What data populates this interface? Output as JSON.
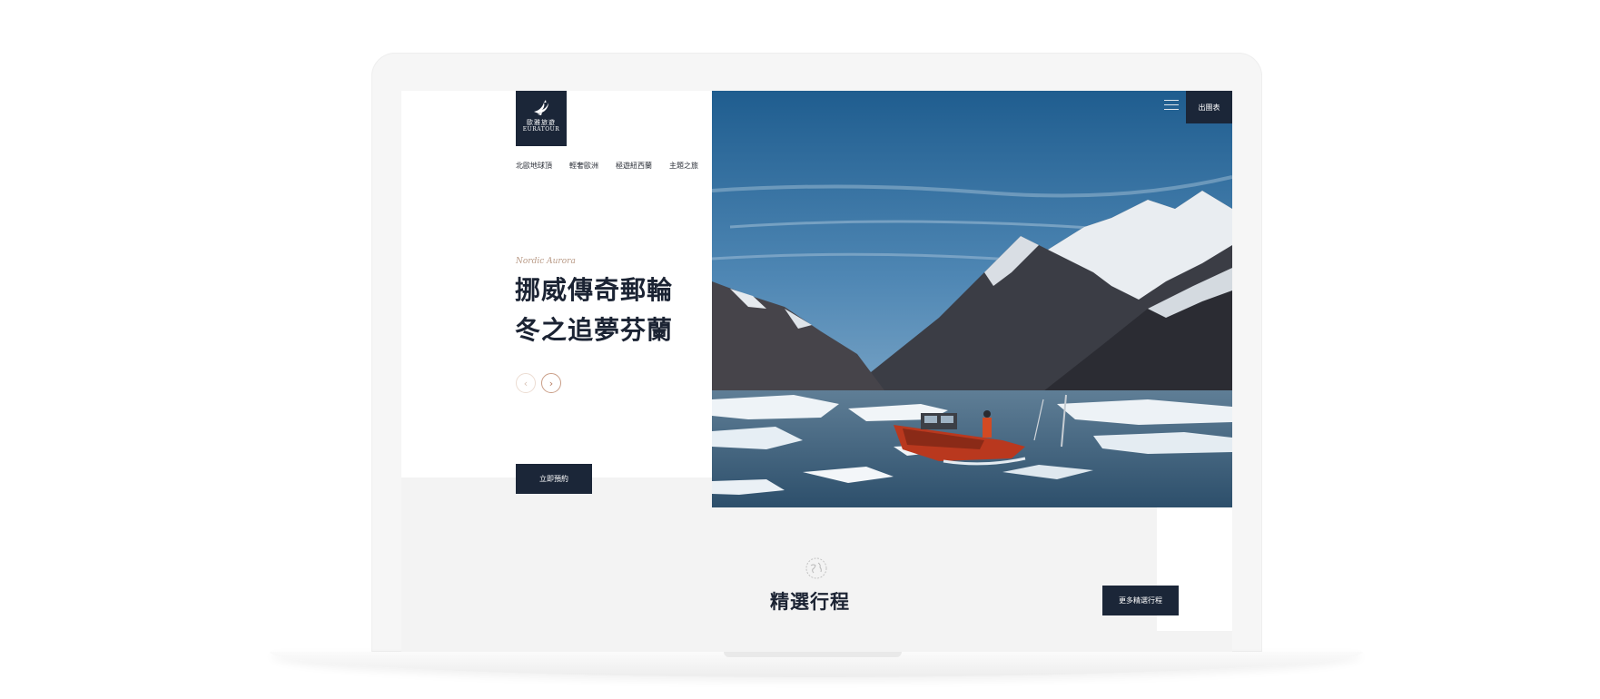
{
  "brand": {
    "name_cn": "歐雅旅遊",
    "name_en": "EURATOUR",
    "logo_icon": "bird-icon"
  },
  "nav": {
    "items": [
      "北歐地球頂",
      "輕奢歐洲",
      "極遊紐西蘭",
      "主題之旅"
    ]
  },
  "hero": {
    "tagline": "Nordic Aurora",
    "headline_line1": "挪威傳奇郵輪",
    "headline_line2": "冬之追夢芬蘭",
    "prev_icon": "chevron-left-icon",
    "next_icon": "chevron-right-icon",
    "prev_glyph": "‹",
    "next_glyph": "›",
    "book_label": "立即預約",
    "image_subject": "arctic-fjord-boat-photo"
  },
  "header": {
    "menu_icon": "hamburger-icon",
    "table_label": "出團表"
  },
  "featured": {
    "icon": "globe-icon",
    "title": "精選行程",
    "more_label": "更多精選行程"
  },
  "colors": {
    "navy": "#1b2638",
    "accent": "#b67c60",
    "background": "#f3f3f3"
  }
}
